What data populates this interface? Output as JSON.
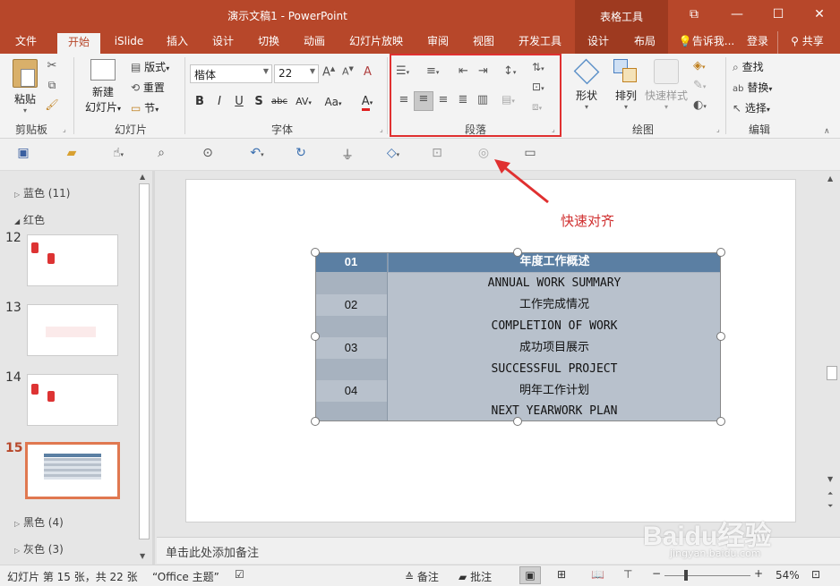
{
  "window": {
    "title": "演示文稿1 - PowerPoint",
    "context_group": "表格工具",
    "buttons": {
      "restore_ribbon": "⧉",
      "minimize": "—",
      "maximize": "☐",
      "close": "✕"
    }
  },
  "tabs": [
    "文件",
    "开始",
    "iSlide",
    "插入",
    "设计",
    "切换",
    "动画",
    "幻灯片放映",
    "审阅",
    "视图",
    "开发工具",
    "设计",
    "布局"
  ],
  "tell_me": "告诉我...",
  "login": "登录",
  "share": "共享",
  "ribbon": {
    "clipboard": {
      "paste": "粘贴",
      "label": "剪贴板"
    },
    "slides": {
      "new_slide_line1": "新建",
      "new_slide_line2": "幻灯片",
      "layout": "版式",
      "reset": "重置",
      "section": "节",
      "label": "幻灯片"
    },
    "font": {
      "font_name": "楷体",
      "font_size": "22",
      "label": "字体",
      "bold": "B",
      "italic": "I",
      "underline": "U",
      "shadow": "S",
      "strike": "abc",
      "spacing": "AV",
      "case": "Aa",
      "color": "A"
    },
    "paragraph": {
      "label": "段落"
    },
    "drawing": {
      "shape": "形状",
      "arrange": "排列",
      "quick_style": "快速样式",
      "label": "绘图"
    },
    "editing": {
      "find": "查找",
      "replace": "替换",
      "select": "选择",
      "label": "编辑"
    }
  },
  "thumbnails": {
    "sections": [
      {
        "name": "蓝色 (11)",
        "expanded": false
      },
      {
        "name": "红色",
        "expanded": true
      },
      {
        "name": "黑色 (4)",
        "expanded": false
      },
      {
        "name": "灰色 (3)",
        "expanded": false
      }
    ],
    "slides": [
      "12",
      "13",
      "14",
      "15"
    ],
    "selected": "15"
  },
  "slide": {
    "annotation": "快速对齐",
    "table": {
      "header": {
        "num": "01",
        "text": "年度工作概述"
      },
      "rows": [
        {
          "num": "",
          "text": "ANNUAL WORK SUMMARY"
        },
        {
          "num": "02",
          "text": "工作完成情况"
        },
        {
          "num": "",
          "text": "COMPLETION OF WORK"
        },
        {
          "num": "03",
          "text": "成功项目展示"
        },
        {
          "num": "",
          "text": "SUCCESSFUL PROJECT"
        },
        {
          "num": "04",
          "text": "明年工作计划"
        },
        {
          "num": "",
          "text": "NEXT YEARWORK PLAN"
        }
      ]
    }
  },
  "notes_placeholder": "单击此处添加备注",
  "status": {
    "slide_info": "幻灯片 第 15 张，共 22 张",
    "theme": "“Office 主题”",
    "notes": "备注",
    "comments": "批注",
    "zoom": "54%"
  },
  "watermark": {
    "text": "Baidu经验",
    "url": "jingyan.baidu.com"
  },
  "colors": {
    "accent": "#b7472a",
    "context": "#9e3a20",
    "highlight": "#e03030",
    "table_header": "#5b7fa3",
    "table_row_light": "#b8c1cc",
    "table_row_dark": "#a7b2bf"
  }
}
